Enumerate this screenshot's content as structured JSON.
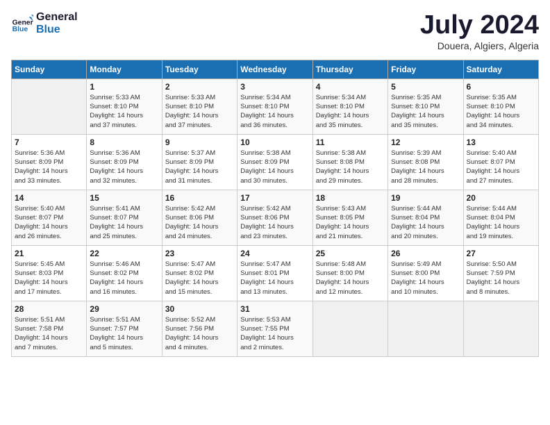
{
  "logo": {
    "line1": "General",
    "line2": "Blue"
  },
  "title": "July 2024",
  "subtitle": "Douera, Algiers, Algeria",
  "days_header": [
    "Sunday",
    "Monday",
    "Tuesday",
    "Wednesday",
    "Thursday",
    "Friday",
    "Saturday"
  ],
  "weeks": [
    [
      {
        "day": "",
        "info": ""
      },
      {
        "day": "1",
        "info": "Sunrise: 5:33 AM\nSunset: 8:10 PM\nDaylight: 14 hours\nand 37 minutes."
      },
      {
        "day": "2",
        "info": "Sunrise: 5:33 AM\nSunset: 8:10 PM\nDaylight: 14 hours\nand 37 minutes."
      },
      {
        "day": "3",
        "info": "Sunrise: 5:34 AM\nSunset: 8:10 PM\nDaylight: 14 hours\nand 36 minutes."
      },
      {
        "day": "4",
        "info": "Sunrise: 5:34 AM\nSunset: 8:10 PM\nDaylight: 14 hours\nand 35 minutes."
      },
      {
        "day": "5",
        "info": "Sunrise: 5:35 AM\nSunset: 8:10 PM\nDaylight: 14 hours\nand 35 minutes."
      },
      {
        "day": "6",
        "info": "Sunrise: 5:35 AM\nSunset: 8:10 PM\nDaylight: 14 hours\nand 34 minutes."
      }
    ],
    [
      {
        "day": "7",
        "info": "Sunrise: 5:36 AM\nSunset: 8:09 PM\nDaylight: 14 hours\nand 33 minutes."
      },
      {
        "day": "8",
        "info": "Sunrise: 5:36 AM\nSunset: 8:09 PM\nDaylight: 14 hours\nand 32 minutes."
      },
      {
        "day": "9",
        "info": "Sunrise: 5:37 AM\nSunset: 8:09 PM\nDaylight: 14 hours\nand 31 minutes."
      },
      {
        "day": "10",
        "info": "Sunrise: 5:38 AM\nSunset: 8:09 PM\nDaylight: 14 hours\nand 30 minutes."
      },
      {
        "day": "11",
        "info": "Sunrise: 5:38 AM\nSunset: 8:08 PM\nDaylight: 14 hours\nand 29 minutes."
      },
      {
        "day": "12",
        "info": "Sunrise: 5:39 AM\nSunset: 8:08 PM\nDaylight: 14 hours\nand 28 minutes."
      },
      {
        "day": "13",
        "info": "Sunrise: 5:40 AM\nSunset: 8:07 PM\nDaylight: 14 hours\nand 27 minutes."
      }
    ],
    [
      {
        "day": "14",
        "info": "Sunrise: 5:40 AM\nSunset: 8:07 PM\nDaylight: 14 hours\nand 26 minutes."
      },
      {
        "day": "15",
        "info": "Sunrise: 5:41 AM\nSunset: 8:07 PM\nDaylight: 14 hours\nand 25 minutes."
      },
      {
        "day": "16",
        "info": "Sunrise: 5:42 AM\nSunset: 8:06 PM\nDaylight: 14 hours\nand 24 minutes."
      },
      {
        "day": "17",
        "info": "Sunrise: 5:42 AM\nSunset: 8:06 PM\nDaylight: 14 hours\nand 23 minutes."
      },
      {
        "day": "18",
        "info": "Sunrise: 5:43 AM\nSunset: 8:05 PM\nDaylight: 14 hours\nand 21 minutes."
      },
      {
        "day": "19",
        "info": "Sunrise: 5:44 AM\nSunset: 8:04 PM\nDaylight: 14 hours\nand 20 minutes."
      },
      {
        "day": "20",
        "info": "Sunrise: 5:44 AM\nSunset: 8:04 PM\nDaylight: 14 hours\nand 19 minutes."
      }
    ],
    [
      {
        "day": "21",
        "info": "Sunrise: 5:45 AM\nSunset: 8:03 PM\nDaylight: 14 hours\nand 17 minutes."
      },
      {
        "day": "22",
        "info": "Sunrise: 5:46 AM\nSunset: 8:02 PM\nDaylight: 14 hours\nand 16 minutes."
      },
      {
        "day": "23",
        "info": "Sunrise: 5:47 AM\nSunset: 8:02 PM\nDaylight: 14 hours\nand 15 minutes."
      },
      {
        "day": "24",
        "info": "Sunrise: 5:47 AM\nSunset: 8:01 PM\nDaylight: 14 hours\nand 13 minutes."
      },
      {
        "day": "25",
        "info": "Sunrise: 5:48 AM\nSunset: 8:00 PM\nDaylight: 14 hours\nand 12 minutes."
      },
      {
        "day": "26",
        "info": "Sunrise: 5:49 AM\nSunset: 8:00 PM\nDaylight: 14 hours\nand 10 minutes."
      },
      {
        "day": "27",
        "info": "Sunrise: 5:50 AM\nSunset: 7:59 PM\nDaylight: 14 hours\nand 8 minutes."
      }
    ],
    [
      {
        "day": "28",
        "info": "Sunrise: 5:51 AM\nSunset: 7:58 PM\nDaylight: 14 hours\nand 7 minutes."
      },
      {
        "day": "29",
        "info": "Sunrise: 5:51 AM\nSunset: 7:57 PM\nDaylight: 14 hours\nand 5 minutes."
      },
      {
        "day": "30",
        "info": "Sunrise: 5:52 AM\nSunset: 7:56 PM\nDaylight: 14 hours\nand 4 minutes."
      },
      {
        "day": "31",
        "info": "Sunrise: 5:53 AM\nSunset: 7:55 PM\nDaylight: 14 hours\nand 2 minutes."
      },
      {
        "day": "",
        "info": ""
      },
      {
        "day": "",
        "info": ""
      },
      {
        "day": "",
        "info": ""
      }
    ]
  ]
}
